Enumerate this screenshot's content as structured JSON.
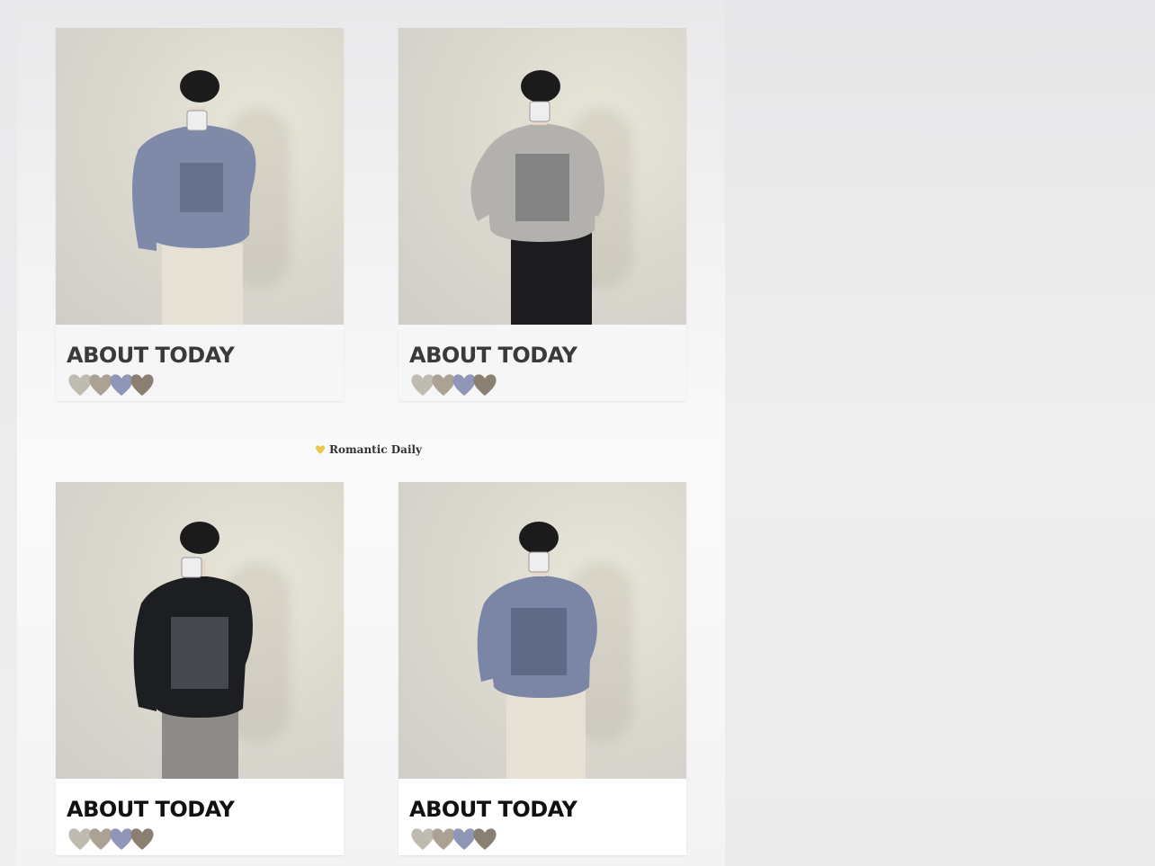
{
  "tagline": {
    "text": "Romantic Daily",
    "icon": "yellow-heart-icon",
    "icon_color": "#e8c94a"
  },
  "cards": [
    {
      "title": "ABOUT TODAY",
      "sweater": "#7f8aa8",
      "pants": "#e6e1d4",
      "hearts": [
        "#bfbbb1",
        "#aca293",
        "#8f96b8",
        "#8a7f70"
      ]
    },
    {
      "title": "ABOUT TODAY",
      "sweater": "#b3b1ad",
      "pants": "#1c1c1e",
      "hearts": [
        "#bfbbb1",
        "#aca293",
        "#8f96b8",
        "#8a7f70"
      ]
    },
    {
      "title": "ABOUT TODAY",
      "sweater": "#1d1e22",
      "pants": "#8e8c88",
      "hearts": [
        "#bfbbb1",
        "#aca293",
        "#8f96b8",
        "#8a7f70"
      ]
    },
    {
      "title": "ABOUT TODAY",
      "sweater": "#7b86a6",
      "pants": "#e6e1d4",
      "hearts": [
        "#bfbbb1",
        "#aca293",
        "#8f96b8",
        "#8a7f70"
      ]
    }
  ]
}
